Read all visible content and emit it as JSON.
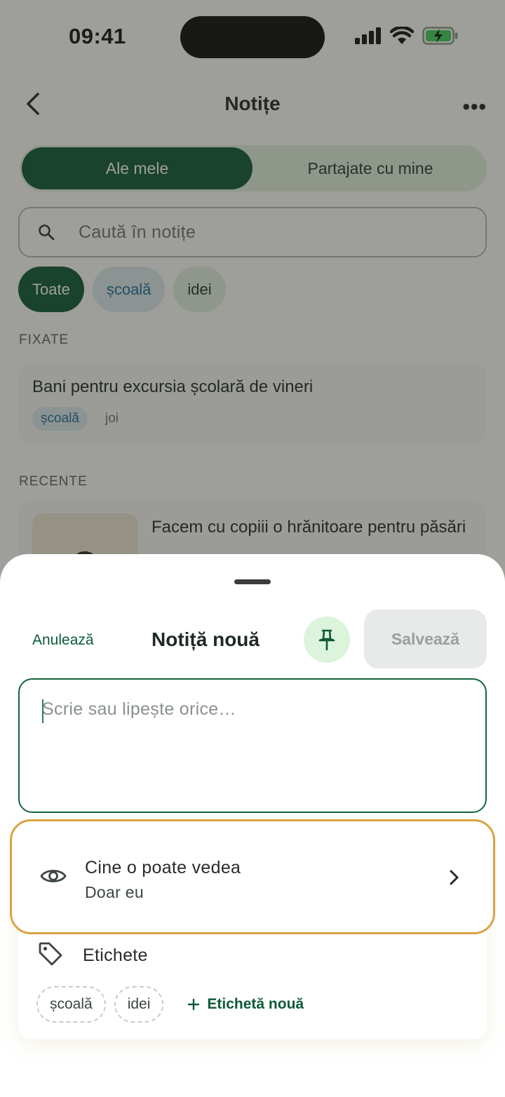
{
  "status": {
    "time": "09:41"
  },
  "nav": {
    "title": "Notițe"
  },
  "segments": {
    "mine": "Ale mele",
    "shared": "Partajate cu mine"
  },
  "search": {
    "placeholder": "Caută în notițe"
  },
  "filters": [
    "Toate",
    "școală",
    "idei"
  ],
  "pinned": {
    "heading": "FIXATE",
    "note": {
      "title": "Bani pentru excursia școlară de vineri",
      "tag": "școală",
      "date": "joi"
    }
  },
  "recent": {
    "heading": "RECENTE",
    "note": {
      "title": "Facem cu copiii o hrănitoare pentru păsări"
    }
  },
  "sheet": {
    "cancel": "Anulează",
    "title": "Notiță nouă",
    "save": "Salvează",
    "editor_placeholder": "Scrie sau lipește orice…",
    "visibility": {
      "title": "Cine o poate vedea",
      "value": "Doar eu"
    },
    "tags": {
      "title": "Etichete",
      "items": [
        "școală",
        "idei"
      ],
      "new_label": "Etichetă nouă"
    }
  },
  "colors": {
    "accent": "#0d5a38",
    "highlight": "#d9a441",
    "school_tag": "#1e6f9a"
  }
}
